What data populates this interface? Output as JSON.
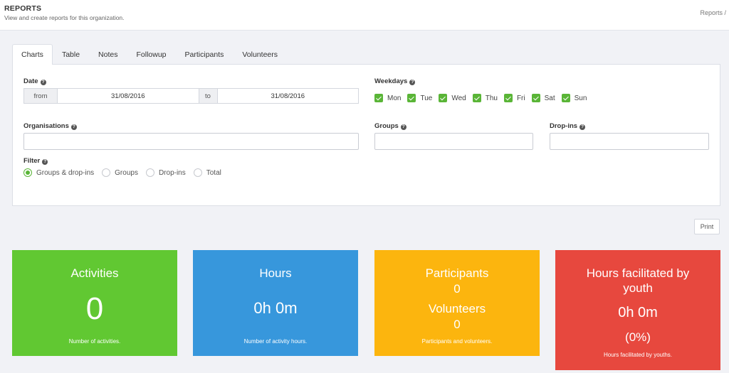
{
  "header": {
    "title": "REPORTS",
    "subtitle": "View and create reports for this organization.",
    "breadcrumb": "Reports /"
  },
  "tabs": [
    {
      "label": "Charts",
      "active": true
    },
    {
      "label": "Table"
    },
    {
      "label": "Notes"
    },
    {
      "label": "Followup"
    },
    {
      "label": "Participants"
    },
    {
      "label": "Volunteers"
    }
  ],
  "filters": {
    "date": {
      "label": "Date",
      "from_label": "from",
      "from_value": "31/08/2016",
      "to_label": "to",
      "to_value": "31/08/2016"
    },
    "weekdays": {
      "label": "Weekdays",
      "days": [
        "Mon",
        "Tue",
        "Wed",
        "Thu",
        "Fri",
        "Sat",
        "Sun"
      ],
      "checked": [
        true,
        true,
        true,
        true,
        true,
        true,
        true
      ]
    },
    "organisations": {
      "label": "Organisations",
      "value": ""
    },
    "groups": {
      "label": "Groups",
      "value": ""
    },
    "dropins": {
      "label": "Drop-ins",
      "value": ""
    },
    "filter": {
      "label": "Filter",
      "options": [
        "Groups & drop-ins",
        "Groups",
        "Drop-ins",
        "Total"
      ],
      "selected": "Groups & drop-ins"
    }
  },
  "print_label": "Print",
  "cards": {
    "activities": {
      "title": "Activities",
      "value": "0",
      "desc": "Number of activities.",
      "color": "#61c832"
    },
    "hours": {
      "title": "Hours",
      "value": "0h 0m",
      "desc": "Number of activity hours.",
      "color": "#3797dc"
    },
    "people": {
      "title1": "Participants",
      "value1": "0",
      "title2": "Volunteers",
      "value2": "0",
      "desc": "Participants and volunteers.",
      "color": "#fcb50e"
    },
    "youth": {
      "title": "Hours facilitated by youth",
      "value": "0h 0m",
      "percent": "(0%)",
      "desc": "Hours facilitated by youths.",
      "color": "#e7483e"
    }
  }
}
